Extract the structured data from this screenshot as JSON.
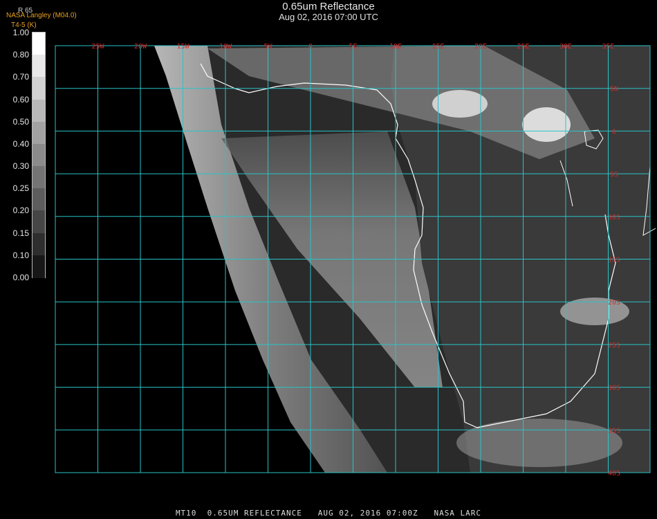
{
  "header": {
    "title": "0.65um Reflectance",
    "subtitle": "Aug 02, 2016 07:00 UTC",
    "provider": "NASA Langley (M04.0)",
    "sub_provider": "T4-5 (K)",
    "band_label": "R 65"
  },
  "colorbar": {
    "labels": [
      "1.00",
      "0.80",
      "0.70",
      "0.60",
      "0.50",
      "0.40",
      "0.30",
      "0.25",
      "0.20",
      "0.15",
      "0.10",
      "0.00"
    ]
  },
  "map": {
    "lon_labels": [
      "25W",
      "20W",
      "15W",
      "10W",
      "5W",
      "0",
      "5E",
      "10E",
      "15E",
      "20E",
      "25E",
      "30E",
      "35E"
    ],
    "lat_labels": [
      "5N",
      "0",
      "5S",
      "10S",
      "15S",
      "20S",
      "25S",
      "30S",
      "35S",
      "40S"
    ],
    "grid_color": "#29c4c8",
    "label_color": "#d42a2a",
    "coast_color": "#ffffff"
  },
  "footer": {
    "text": "MT10  0.65UM REFLECTANCE   AUG 02, 2016 07:00Z   NASA LARC"
  }
}
